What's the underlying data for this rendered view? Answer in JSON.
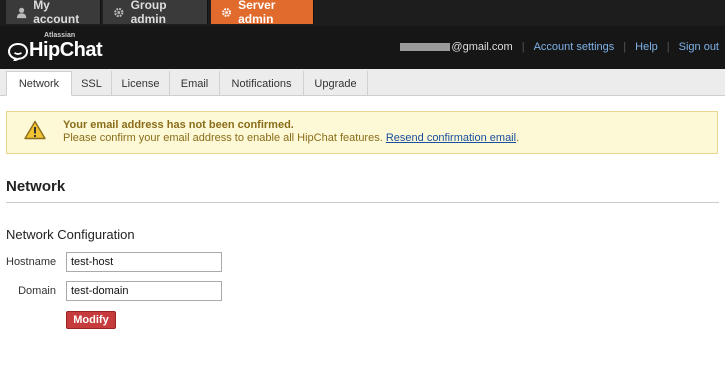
{
  "top_tabs": [
    {
      "label": "My account",
      "icon": "user-icon"
    },
    {
      "label": "Group admin",
      "icon": "gear-icon"
    },
    {
      "label": "Server admin",
      "icon": "gear-icon",
      "active": true
    }
  ],
  "header": {
    "logo_small": "Atlassian",
    "logo_text": "HipChat",
    "email_visible": "@gmail.com",
    "links": [
      "Account settings",
      "Help",
      "Sign out"
    ]
  },
  "sub_tabs": [
    "Network",
    "SSL",
    "License",
    "Email",
    "Notifications",
    "Upgrade"
  ],
  "alert": {
    "title": "Your email address has not been confirmed.",
    "body": "Please confirm your email address to enable all HipChat features.",
    "link": "Resend confirmation email",
    "trailing": ".",
    "icon": "warning-icon"
  },
  "page": {
    "title": "Network",
    "section": "Network Configuration"
  },
  "form": {
    "hostname_label": "Hostname",
    "hostname_value": "test-host",
    "domain_label": "Domain",
    "domain_value": "test-domain",
    "submit_label": "Modify"
  },
  "colors": {
    "active_tab": "#e06b2c",
    "header_bg": "#161616",
    "alert_bg": "#fdf8d5",
    "button": "#c63c3c",
    "link": "#7fb2e8"
  }
}
